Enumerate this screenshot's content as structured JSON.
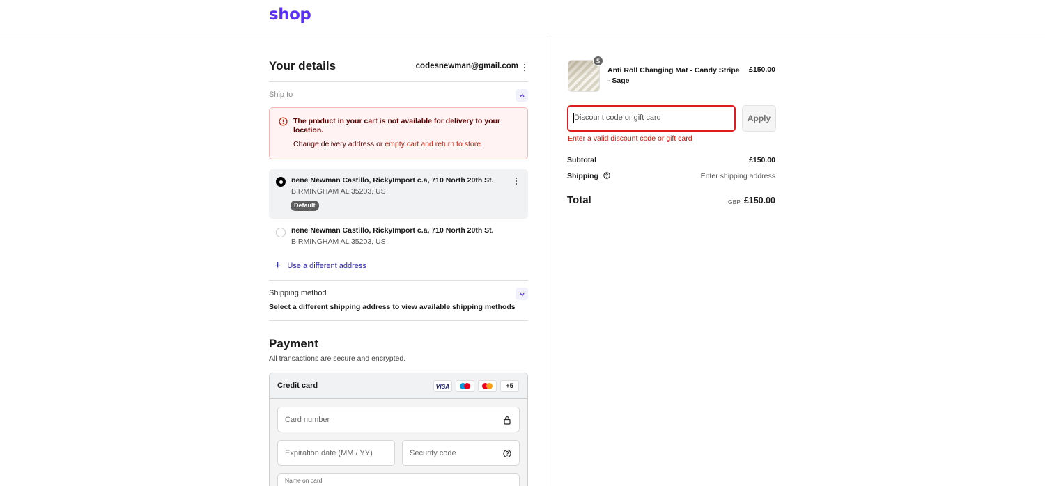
{
  "header": {
    "logo": "shop"
  },
  "details": {
    "title": "Your details",
    "email": "codesnewman@gmail.com",
    "ship_to_label": "Ship to"
  },
  "error": {
    "message": "The product in your cart is not available for delivery to your location.",
    "action_prefix": "Change delivery address or ",
    "action_link": "empty cart and return to store."
  },
  "addresses": [
    {
      "line1": "nene Newman Castillo, RickyImport c.a, 710 North 20th St.",
      "line2": "BIRMINGHAM AL 35203, US",
      "badge": "Default",
      "selected": true
    },
    {
      "line1": "nene Newman Castillo, RickyImport c.a, 710 North 20th St.",
      "line2": "BIRMINGHAM AL 35203, US",
      "selected": false
    }
  ],
  "use_different_address": "Use a different address",
  "shipping_method": {
    "label": "Shipping method",
    "text": "Select a different shipping address to view available shipping methods"
  },
  "payment": {
    "title": "Payment",
    "subtitle": "All transactions are secure and encrypted.",
    "method": "Credit card",
    "brands": [
      "VISA",
      "maestro-icon",
      "mastercard-icon",
      "+5"
    ],
    "card_number_placeholder": "Card number",
    "expiry_placeholder": "Expiration date (MM / YY)",
    "security_placeholder": "Security code",
    "name_label": "Name on card"
  },
  "summary": {
    "product": {
      "name": "Anti Roll Changing Mat - Candy Stripe - Sage",
      "price": "£150.00",
      "quantity": "5"
    },
    "discount_placeholder": "Discount code or gift card",
    "apply_label": "Apply",
    "discount_error": "Enter a valid discount code or gift card",
    "subtotal_label": "Subtotal",
    "subtotal_value": "£150.00",
    "shipping_label": "Shipping",
    "shipping_value": "Enter shipping address",
    "total_label": "Total",
    "total_currency": "GBP",
    "total_value": "£150.00"
  },
  "colors": {
    "brand": "#5a31f4",
    "error": "#c41c0b",
    "link": "#2c26a8"
  }
}
